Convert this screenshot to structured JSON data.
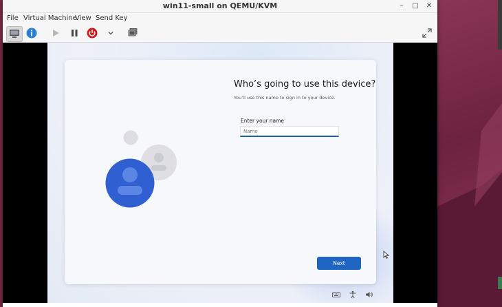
{
  "window": {
    "title": "win11-small on QEMU/KVM",
    "controls": {
      "minimize": "–",
      "maximize": "□",
      "close": "✕"
    }
  },
  "menubar": {
    "items": [
      "File",
      "Virtual Machine",
      "View",
      "Send Key"
    ]
  },
  "toolbar": {
    "buttons": [
      "console",
      "details",
      "run",
      "pause",
      "shutdown",
      "shutdown-menu",
      "snapshots",
      "fullscreen"
    ],
    "shutdown_color": "#d01919",
    "details_color": "#2a7fd6"
  },
  "guest": {
    "heading": "Who’s going to use this device?",
    "subtitle": "You’ll use this name to sign in to your device.",
    "field_label": "Enter your name",
    "field_placeholder": "Name",
    "field_value": "",
    "next_label": "Next",
    "accent": "#1f66c2",
    "taskbar_icons": [
      "keyboard-icon",
      "accessibility-icon",
      "volume-icon"
    ]
  }
}
